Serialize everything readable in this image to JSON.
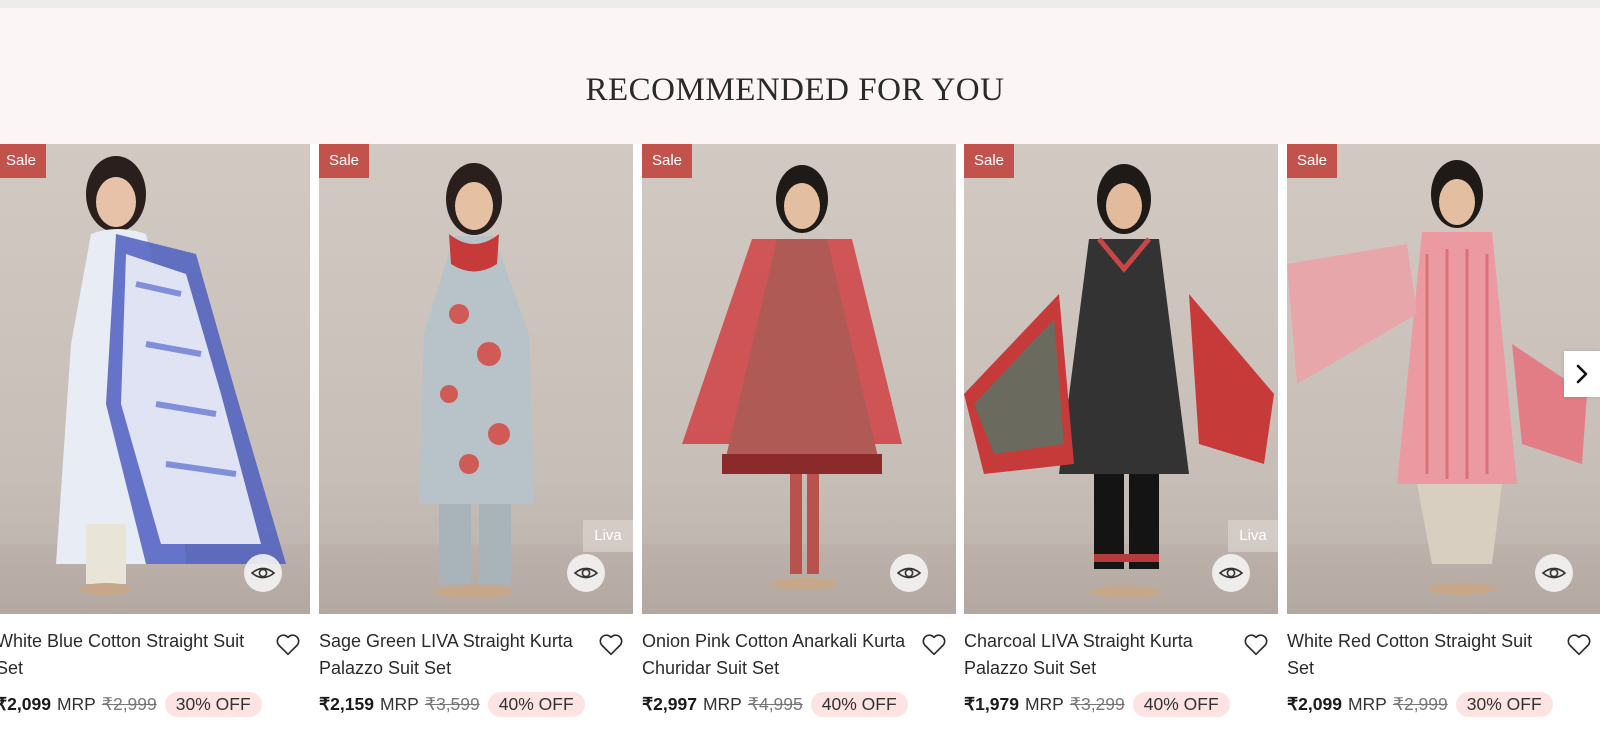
{
  "section": {
    "title": "RECOMMENDED FOR YOU"
  },
  "colors": {
    "sale_badge": "#c2524c",
    "discount_pill": "#fde3e2",
    "banner": "#fbf6f5"
  },
  "icons": {
    "quick_view": "eye-icon",
    "wishlist": "heart-icon",
    "next": "chevron-right-icon"
  },
  "products": [
    {
      "badge": "Sale",
      "brand_tag": "",
      "name": "White Blue Cotton Straight Suit Set",
      "price": "₹2,099",
      "mrp_label": "MRP",
      "mrp": "₹2,999",
      "discount": "30% OFF"
    },
    {
      "badge": "Sale",
      "brand_tag": "Liva",
      "name": "Sage Green LIVA Straight Kurta Palazzo Suit Set",
      "price": "₹2,159",
      "mrp_label": "MRP",
      "mrp": "₹3,599",
      "discount": "40% OFF"
    },
    {
      "badge": "Sale",
      "brand_tag": "",
      "name": "Onion Pink Cotton Anarkali Kurta Churidar Suit Set",
      "price": "₹2,997",
      "mrp_label": "MRP",
      "mrp": "₹4,995",
      "discount": "40% OFF"
    },
    {
      "badge": "Sale",
      "brand_tag": "Liva",
      "name": "Charcoal LIVA Straight Kurta Palazzo Suit Set",
      "price": "₹1,979",
      "mrp_label": "MRP",
      "mrp": "₹3,299",
      "discount": "40% OFF"
    },
    {
      "badge": "Sale",
      "brand_tag": "",
      "name": "White Red Cotton Straight Suit Set",
      "price": "₹2,099",
      "mrp_label": "MRP",
      "mrp": "₹2,999",
      "discount": "30% OFF"
    }
  ]
}
